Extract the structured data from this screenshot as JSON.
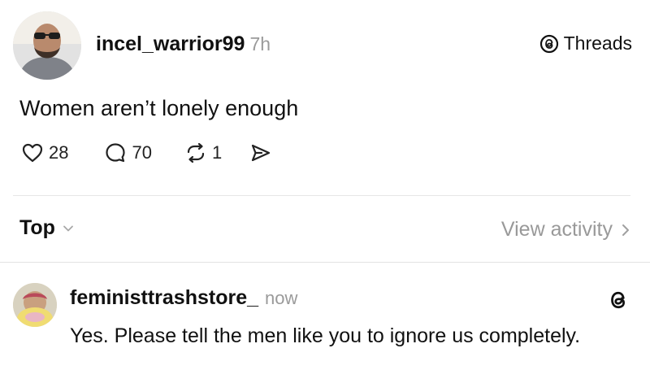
{
  "post": {
    "username": "incel_warrior99",
    "time": "7h",
    "platform_label": "Threads",
    "text": "Women aren’t lonely enough",
    "likes": "28",
    "replies": "70",
    "reposts": "1"
  },
  "activity": {
    "sort_label": "Top",
    "view_activity_label": "View activity"
  },
  "reply": {
    "username": "feministtrashstore_",
    "time": "now",
    "text": "Yes. Please tell the men like you to ignore us completely."
  },
  "icons": {
    "like": "heart-icon",
    "reply": "speech-bubble-icon",
    "repost": "repost-icon",
    "share": "send-icon",
    "threads": "threads-logo-icon",
    "sort": "chevron-down-icon",
    "view_activity": "chevron-right-icon"
  },
  "colors": {
    "text": "#111111",
    "muted": "#999999",
    "divider": "#e6e6e6"
  }
}
